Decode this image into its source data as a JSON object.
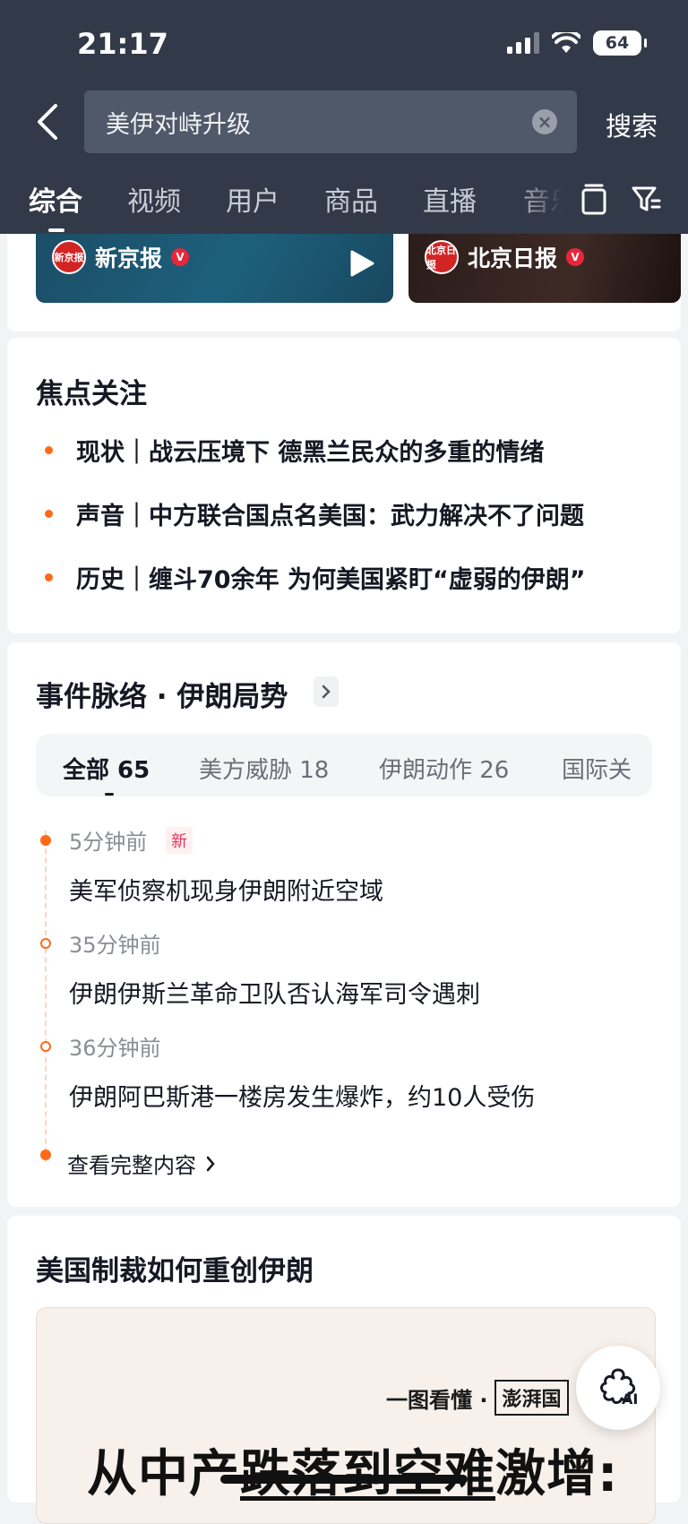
{
  "status_bar": {
    "time": "21:17",
    "battery": "64"
  },
  "search": {
    "query": "美伊对峙升级",
    "button": "搜索"
  },
  "tabs": [
    "综合",
    "视频",
    "用户",
    "商品",
    "直播",
    "音乐"
  ],
  "videos": [
    {
      "source": "新京报",
      "logo_text": "新京报",
      "verified": "V"
    },
    {
      "source": "北京日报",
      "logo_text": "北京日报",
      "verified": "V"
    }
  ],
  "focus": {
    "title": "焦点关注",
    "items": [
      "现状｜战云压境下 德黑兰民众的多重的情绪",
      "声音｜中方联合国点名美国：武力解决不了问题",
      "历史｜缠斗70余年 为何美国紧盯“虚弱的伊朗”"
    ]
  },
  "timeline": {
    "title": "事件脉络 · 伊朗局势",
    "filters": [
      "全部 65",
      "美方威胁 18",
      "伊朗动作 26",
      "国际关"
    ],
    "events": [
      {
        "time": "5分钟前",
        "badge": "新",
        "text": "美军侦察机现身伊朗附近空域"
      },
      {
        "time": "35分钟前",
        "text": "伊朗伊斯兰革命卫队否认海军司令遇刺"
      },
      {
        "time": "36分钟前",
        "text": "伊朗阿巴斯港一楼房发生爆炸，约10人受伤"
      }
    ],
    "more": "查看完整内容"
  },
  "sanctions": {
    "title": "美国制裁如何重创伊朗",
    "poster_tag": "一图看懂 ·",
    "poster_logo": "澎湃国",
    "poster_headline_1": "从中产",
    "poster_headline_2": "跌落到空难",
    "poster_headline_3": "激增:"
  },
  "ai_button": "AI"
}
